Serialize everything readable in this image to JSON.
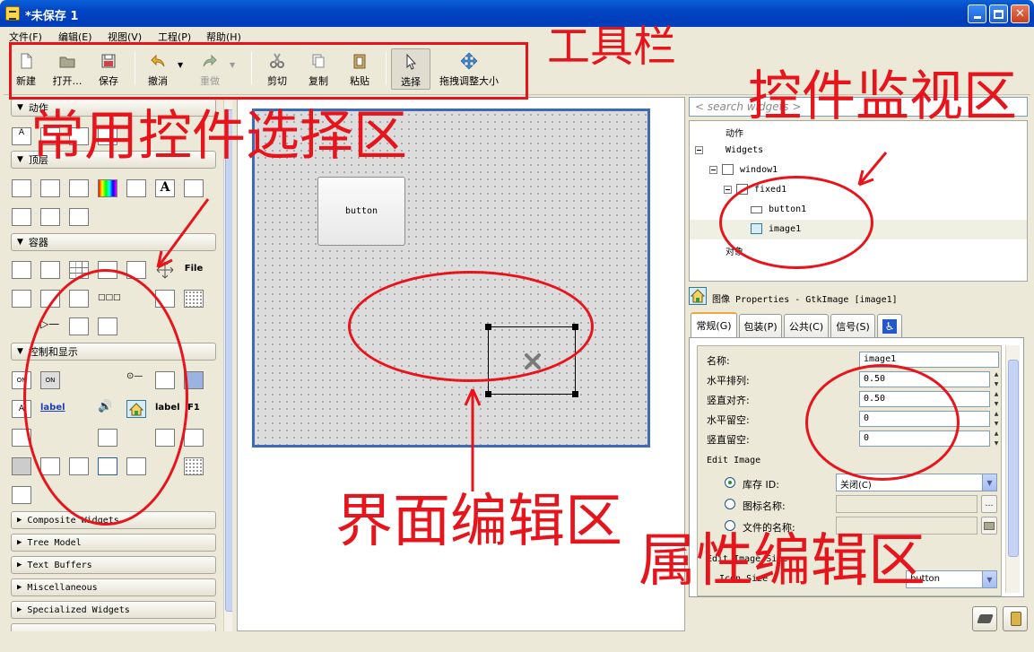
{
  "window": {
    "title": "*未保存 1"
  },
  "menu": {
    "items": [
      "文件(F)",
      "编辑(E)",
      "视图(V)",
      "工程(P)",
      "帮助(H)"
    ]
  },
  "toolbar": {
    "new": "新建",
    "open": "打开…",
    "save": "保存",
    "undo": "撤消",
    "redo": "重做",
    "cut": "剪切",
    "copy": "复制",
    "paste": "粘贴",
    "select": "选择",
    "drag_resize": "拖拽调整大小"
  },
  "palette": {
    "groups": {
      "actions": "动作",
      "toplevels": "顶层",
      "containers": "容器",
      "control_display": "控制和显示",
      "composite": "Composite Widgets",
      "tree_model": "Tree Model",
      "text_buffers": "Text Buffers",
      "misc": "Miscellaneous",
      "specialized": "Specialized Widgets"
    },
    "icon_texts": {
      "file": "File",
      "on1": "ON",
      "on2": "ON",
      "label_link": "label",
      "label_plain": "label",
      "f1": "F1",
      "big_a": "A"
    }
  },
  "editor": {
    "button_label": "button"
  },
  "inspector": {
    "search_placeholder": "< search widgets >",
    "tree": {
      "actions": "动作",
      "widgets": "Widgets",
      "window1": "window1",
      "fixed1": "fixed1",
      "button1": "button1",
      "image1": "image1",
      "objects": "对象"
    }
  },
  "properties": {
    "title": "图像 Properties - GtkImage [image1]",
    "tabs": [
      "常规(G)",
      "包装(P)",
      "公共(C)",
      "信号(S)"
    ],
    "fields": {
      "name_label": "名称:",
      "name_value": "image1",
      "xalign_label": "水平排列:",
      "xalign_value": "0.50",
      "yalign_label": "竖直对齐:",
      "yalign_value": "0.50",
      "xpad_label": "水平留空:",
      "xpad_value": "0",
      "ypad_label": "竖直留空:",
      "ypad_value": "0",
      "edit_image": "Edit Image",
      "stock_id_label": "库存 ID:",
      "stock_id_value": "关闭(C)",
      "icon_name_label": "图标名称:",
      "file_name_label": "文件的名称:",
      "size_header": "Edit Image Size",
      "icon_size_label": "Icon Size",
      "icon_size_value": "button"
    }
  },
  "annotations": {
    "toolbar": "工具栏",
    "palette": "常用控件选择区",
    "inspector": "控件监视区",
    "editor": "界面编辑区",
    "properties": "属性编辑区"
  },
  "colors": {
    "annotation": "#e8141c",
    "canvas_border": "#3e6ab9",
    "title_bar": "#0245c4"
  }
}
